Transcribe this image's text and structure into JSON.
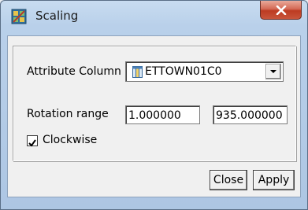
{
  "window": {
    "title": "Scaling"
  },
  "form": {
    "attribute_column_label": "Attribute Column",
    "attribute_column_value": "ETTOWN01C0",
    "rotation_range_label": "Rotation range",
    "rotation_min": "1.000000",
    "rotation_max": "935.000000",
    "clockwise_label": "Clockwise",
    "clockwise_checked": true
  },
  "buttons": {
    "close": "Close",
    "apply": "Apply"
  },
  "colors": {
    "title_close": "#c8553b",
    "dialog_bg": "#f0f0f0",
    "frame": "#b9d0ea"
  }
}
